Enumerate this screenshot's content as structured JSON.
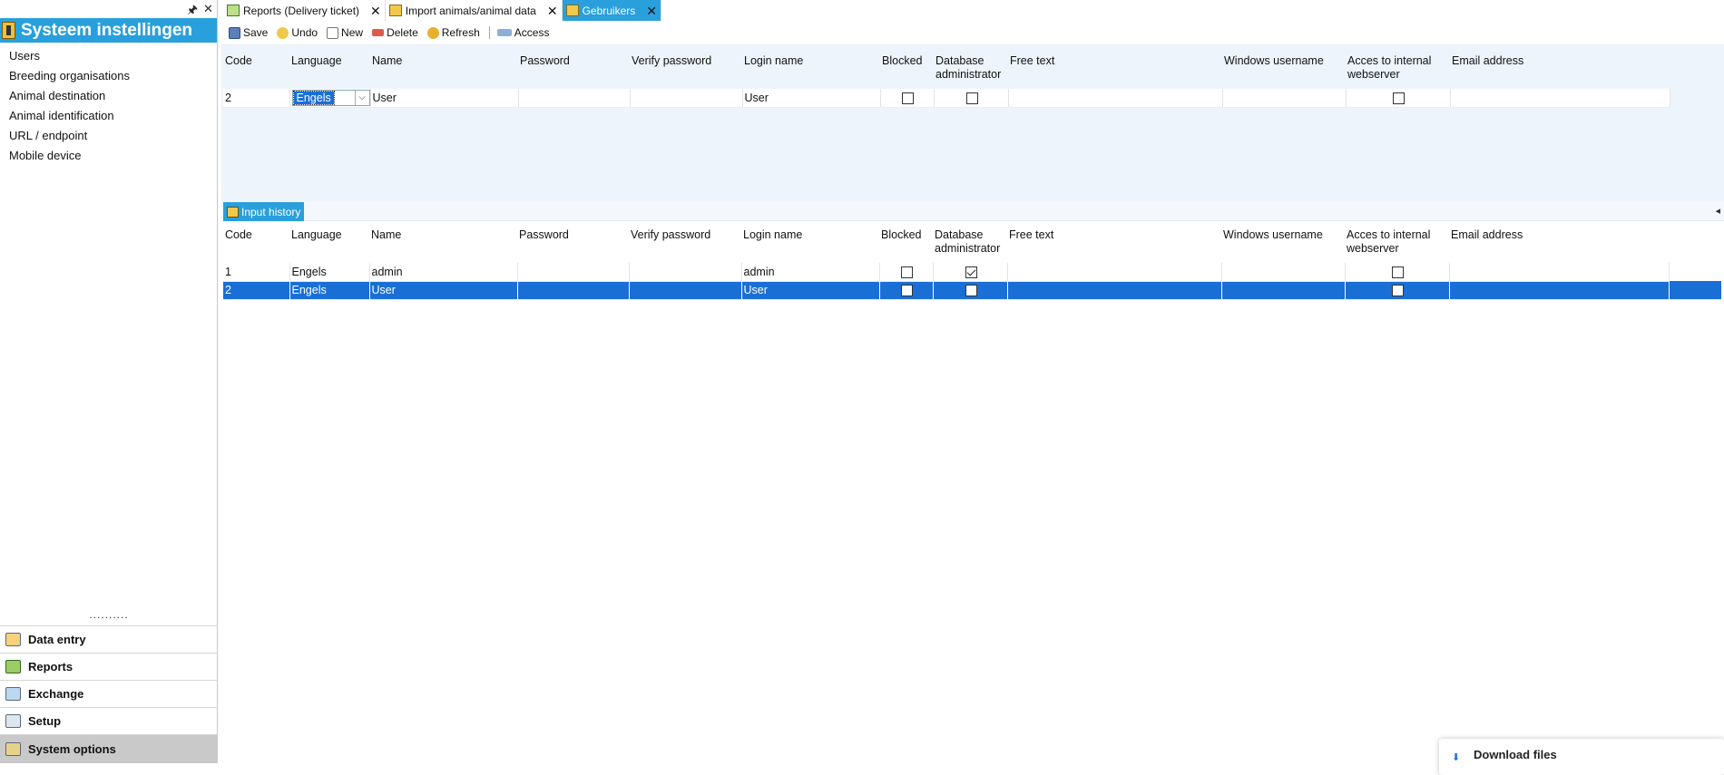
{
  "left_panel": {
    "pin_glyph": "🖈",
    "close_glyph": "✕",
    "title": "Systeem instellingen",
    "items": [
      {
        "label": "Users"
      },
      {
        "label": "Breeding organisations"
      },
      {
        "label": "Animal destination"
      },
      {
        "label": "Animal identification"
      },
      {
        "label": "URL / endpoint"
      },
      {
        "label": "Mobile device"
      }
    ],
    "dots": "..........",
    "nav": [
      {
        "label": "Data entry",
        "icon": "data-entry-icon"
      },
      {
        "label": "Reports",
        "icon": "reports-icon"
      },
      {
        "label": "Exchange",
        "icon": "exchange-icon"
      },
      {
        "label": "Setup",
        "icon": "setup-icon"
      },
      {
        "label": "System options",
        "icon": "system-options-icon",
        "active": true
      }
    ]
  },
  "tabs": [
    {
      "label": "Reports (Delivery ticket)",
      "close": "✕",
      "active": false
    },
    {
      "label": "Import animals/animal data",
      "close": "✕",
      "active": false
    },
    {
      "label": "Gebruikers",
      "close": "✕",
      "active": true
    }
  ],
  "toolbar": {
    "save": "Save",
    "undo": "Undo",
    "new": "New",
    "delete": "Delete",
    "refresh": "Refresh",
    "access": "Access"
  },
  "columns": {
    "code": "Code",
    "language": "Language",
    "name": "Name",
    "password": "Password",
    "verify_password": "Verify password",
    "login_name": "Login name",
    "blocked": "Blocked",
    "db_admin": "Database administrator",
    "free_text": "Free text",
    "windows_username": "Windows username",
    "internal_webserver": "Acces to internal webserver",
    "email": "Email address"
  },
  "edit_row": {
    "code": "2",
    "language": "Engels",
    "dropdown_glyph": "⌵",
    "name": "User",
    "password": "",
    "verify_password": "",
    "login_name": "User",
    "blocked": false,
    "db_admin": false,
    "free_text": "",
    "windows_username": "",
    "internal_webserver": false,
    "email": ""
  },
  "history": {
    "tab_label": "Input history",
    "collapse_glyph": "◂",
    "rows": [
      {
        "code": "1",
        "language": "Engels",
        "name": "admin",
        "password": "",
        "verify_password": "",
        "login_name": "admin",
        "blocked": false,
        "db_admin": true,
        "free_text": "",
        "windows_username": "",
        "internal_webserver": false,
        "email": ""
      },
      {
        "code": "2",
        "language": "Engels",
        "name": "User",
        "password": "",
        "verify_password": "",
        "login_name": "User",
        "blocked": false,
        "db_admin": false,
        "free_text": "",
        "windows_username": "",
        "internal_webserver": false,
        "email": "",
        "selected": true
      }
    ]
  },
  "download_popup": {
    "icon": "⬇",
    "label": "Download files"
  },
  "colors": {
    "accent": "#29a0dc",
    "selection": "#1a6fd6",
    "panel_bg": "#edf4fb"
  }
}
